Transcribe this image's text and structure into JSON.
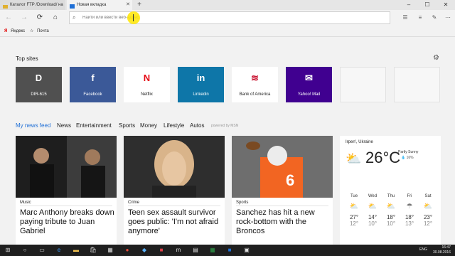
{
  "tabs": [
    {
      "label": "Каталог FTP /Download/ на"
    },
    {
      "label": "Новая вкладка"
    }
  ],
  "address": {
    "placeholder": "Найти или ввести веб-адрес"
  },
  "favorites": [
    {
      "label": "Яндекс"
    },
    {
      "label": "Почта"
    }
  ],
  "top_sites": {
    "title": "Top sites",
    "tiles": [
      {
        "label": "DIR-615",
        "logo": "D",
        "bg": "#505050",
        "fg": "#ffffff"
      },
      {
        "label": "Facebook",
        "logo": "f",
        "bg": "#3b5998",
        "fg": "#ffffff"
      },
      {
        "label": "Netflix",
        "logo": "N",
        "bg": "#ffffff",
        "fg": "#e50914"
      },
      {
        "label": "Linkedin",
        "logo": "in",
        "bg": "#0e76a8",
        "fg": "#ffffff"
      },
      {
        "label": "Bank of America",
        "logo": "≋",
        "bg": "#ffffff",
        "fg": "#c8102e"
      },
      {
        "label": "Yahoo! Mail",
        "logo": "✉",
        "bg": "#400090",
        "fg": "#ffffff"
      },
      {
        "label": "",
        "logo": "",
        "bg": "#f7f7f7",
        "fg": "#000000"
      },
      {
        "label": "",
        "logo": "",
        "bg": "#f7f7f7",
        "fg": "#000000"
      }
    ]
  },
  "feed": {
    "tabs": [
      "My news feed",
      "News",
      "Entertainment",
      "Sports",
      "Money",
      "Lifestyle",
      "Autos"
    ],
    "powered": "powered by MSN",
    "cards": [
      {
        "category": "Music",
        "headline": "Marc Anthony breaks down paying tribute to Juan Gabriel",
        "img_color": "#2a2a2a"
      },
      {
        "category": "Crime",
        "headline": "Teen sex assault survivor goes public: 'I'm not afraid anymore'",
        "img_color": "#3a3a3a"
      },
      {
        "category": "Sports",
        "headline": "Sanchez has hit a new rock-bottom with the Broncos",
        "img_color": "#e86a1a"
      }
    ]
  },
  "weather": {
    "location": "Irpen', Ukraine",
    "temp": "26°C",
    "condition": "Partly Sunny",
    "humidity": "💧 16%",
    "days": [
      {
        "day": "Tue",
        "hi": "27°",
        "lo": "12°"
      },
      {
        "day": "Wed",
        "hi": "14°",
        "lo": "10°"
      },
      {
        "day": "Thu",
        "hi": "18°",
        "lo": "10°"
      },
      {
        "day": "Fri",
        "hi": "18°",
        "lo": "13°"
      },
      {
        "day": "Sat",
        "hi": "23°",
        "lo": "12°"
      }
    ]
  },
  "taskbar": {
    "lang": "ENG",
    "time": "16:47",
    "date": "30.08.2016"
  }
}
